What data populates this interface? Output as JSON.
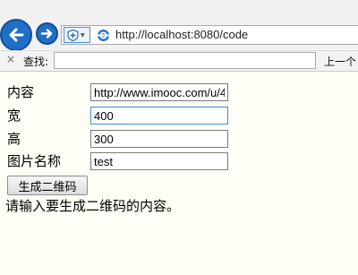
{
  "browser": {
    "url": "http://localhost:8080/code",
    "back_icon": "back-arrow-icon",
    "forward_icon": "forward-arrow-icon",
    "compat_icon": "shield-plus-icon",
    "site_icon": "ie-page-icon",
    "accent": "#1f6fc6"
  },
  "find_bar": {
    "close_label": "×",
    "label": "查找:",
    "value": "",
    "prev_label": "上一个"
  },
  "form": {
    "content_label": "内容",
    "content_value": "http://www.imooc.com/u/4",
    "width_label": "宽",
    "width_value": "400",
    "height_label": "高",
    "height_value": "300",
    "name_label": "图片名称",
    "name_value": "test",
    "submit_label": "生成二维码"
  },
  "message": "请输入要生成二维码的内容。"
}
